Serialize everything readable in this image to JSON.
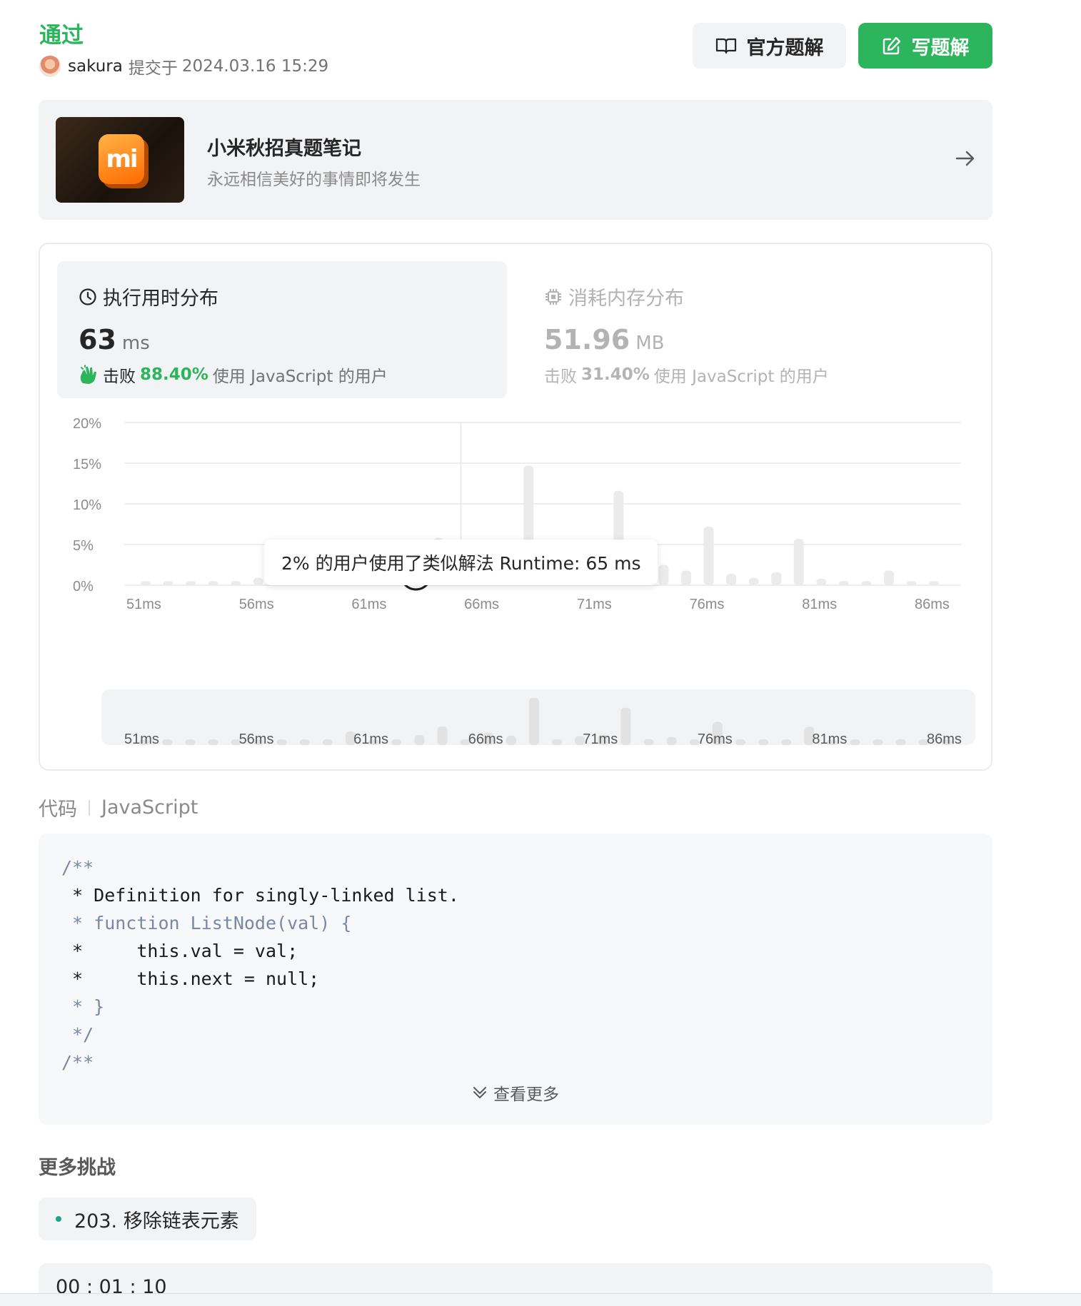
{
  "header": {
    "status": "通过",
    "user": "sakura",
    "submitted_prefix": "提交于",
    "submitted_time": "2024.03.16 15:29",
    "official_solution_label": "官方题解",
    "write_solution_label": "写题解"
  },
  "banner": {
    "logo_text": "mi",
    "title": "小米秋招真题笔记",
    "subtitle": "永远相信美好的事情即将发生"
  },
  "runtime": {
    "title": "执行用时分布",
    "value": "63",
    "unit": "ms",
    "beat_prefix": "击败",
    "beat_pct": "88.40%",
    "beat_suffix": "使用 JavaScript 的用户"
  },
  "memory": {
    "title": "消耗内存分布",
    "value": "51.96",
    "unit": "MB",
    "beat_prefix": "击败",
    "beat_pct": "31.40%",
    "beat_suffix": "使用 JavaScript 的用户"
  },
  "tooltip": "2% 的用户使用了类似解法 Runtime: 65 ms",
  "chart_data": {
    "type": "bar",
    "ylabel": "",
    "xlabel": "",
    "ylim": [
      0,
      20
    ],
    "y_ticks": [
      "0%",
      "5%",
      "10%",
      "15%",
      "20%"
    ],
    "x_tick_labels": [
      "51ms",
      "56ms",
      "61ms",
      "66ms",
      "71ms",
      "76ms",
      "81ms",
      "86ms"
    ],
    "x": [
      51,
      52,
      53,
      54,
      55,
      56,
      57,
      58,
      59,
      60,
      61,
      62,
      63,
      64,
      65,
      66,
      67,
      68,
      69,
      70,
      71,
      72,
      73,
      74,
      75,
      76,
      77,
      78,
      79,
      80,
      81,
      82,
      83,
      84,
      85,
      86
    ],
    "values": [
      0.5,
      0.5,
      0.5,
      0.5,
      0.5,
      0.9,
      0.5,
      0.5,
      1.1,
      4.2,
      0.5,
      1.5,
      3.1,
      5.8,
      1.7,
      3.9,
      2.9,
      14.7,
      1.1,
      2.8,
      3.2,
      11.6,
      1.9,
      2.5,
      1.8,
      7.2,
      1.4,
      0.9,
      1.6,
      5.7,
      0.8,
      0.5,
      0.5,
      1.8,
      0.5,
      0.5
    ],
    "highlight": [
      63,
      65
    ],
    "colors": {
      "bar": "#ebebeb",
      "highlight": "#1f1f1f",
      "grid": "#e8e8e8"
    },
    "grid": true
  },
  "code": {
    "label": "代码",
    "language": "JavaScript",
    "lines": [
      {
        "text": "/**",
        "cls": "c-grey"
      },
      {
        "text": " * Definition for singly-linked list.",
        "cls": "c-dark"
      },
      {
        "text": " * function ListNode(val) {",
        "cls": "c-grey"
      },
      {
        "text": " *     this.val = val;",
        "cls": "c-dark"
      },
      {
        "text": " *     this.next = null;",
        "cls": "c-dark"
      },
      {
        "text": " * }",
        "cls": "c-grey"
      },
      {
        "text": " */",
        "cls": "c-grey"
      },
      {
        "text": "/**",
        "cls": "c-grey"
      }
    ],
    "more_label": "查看更多"
  },
  "more": {
    "title": "更多挑战",
    "challenge": "203. 移除链表元素"
  },
  "timer": "00 : 01 : 10"
}
